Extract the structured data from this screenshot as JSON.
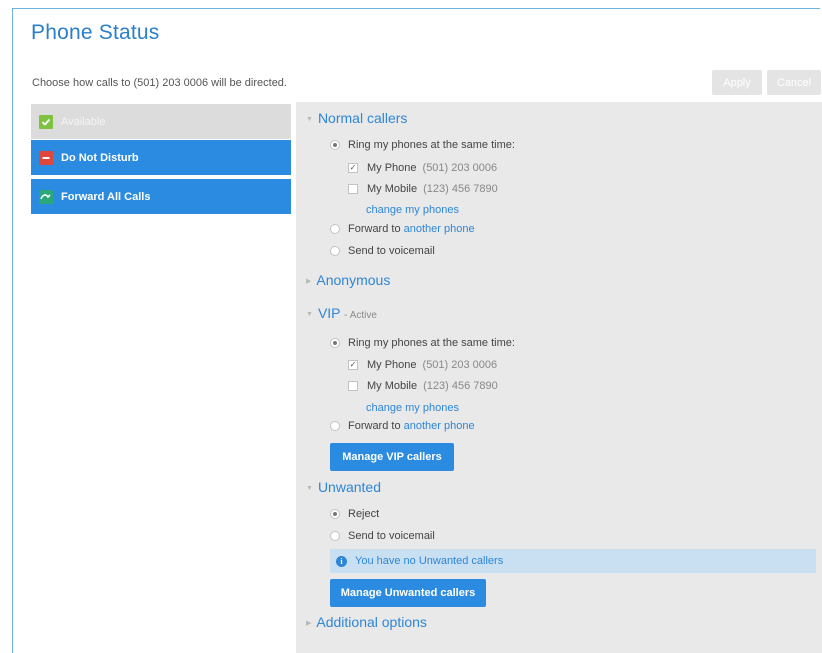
{
  "header": {
    "title": "Phone Status",
    "subtitle": "Choose how calls to (501) 203 0006 will be directed.",
    "apply_label": "Apply",
    "cancel_label": "Cancel"
  },
  "statuses": [
    {
      "label": "Available",
      "icon": "check-icon",
      "color": "#7fc241",
      "state": "disabled"
    },
    {
      "label": "Do Not Disturb",
      "icon": "minus-icon",
      "color": "#e0473c"
    },
    {
      "label": "Forward All Calls",
      "icon": "forward-icon",
      "color": "#2aa87a"
    }
  ],
  "normal": {
    "title": "Normal callers",
    "ring_label": "Ring my phones at the same time:",
    "phone1_name": "My Phone",
    "phone1_num": "(501) 203 0006",
    "phone2_name": "My Mobile",
    "phone2_num": "(123) 456 7890",
    "change_link": "change my phones",
    "forward_prefix": "Forward to",
    "forward_link": "another phone",
    "voicemail_label": "Send to voicemail"
  },
  "anonymous": {
    "title": "Anonymous"
  },
  "vip": {
    "title": "VIP",
    "active_tag": "- Active",
    "ring_label": "Ring my phones at the same time:",
    "phone1_name": "My Phone",
    "phone1_num": "(501) 203 0006",
    "phone2_name": "My Mobile",
    "phone2_num": "(123) 456 7890",
    "change_link": "change my phones",
    "forward_prefix": "Forward to",
    "forward_link": "another phone",
    "manage_label": "Manage VIP callers"
  },
  "unwanted": {
    "title": "Unwanted",
    "reject_label": "Reject",
    "voicemail_label": "Send to voicemail",
    "info_text": "You have no Unwanted callers",
    "manage_label": "Manage Unwanted callers"
  },
  "additional": {
    "title": "Additional options"
  },
  "colors": {
    "accent": "#2b8be0",
    "title_blue": "#2b7fc9",
    "panel_bg": "#e9e9e9",
    "info_bg": "#c9dff2"
  }
}
